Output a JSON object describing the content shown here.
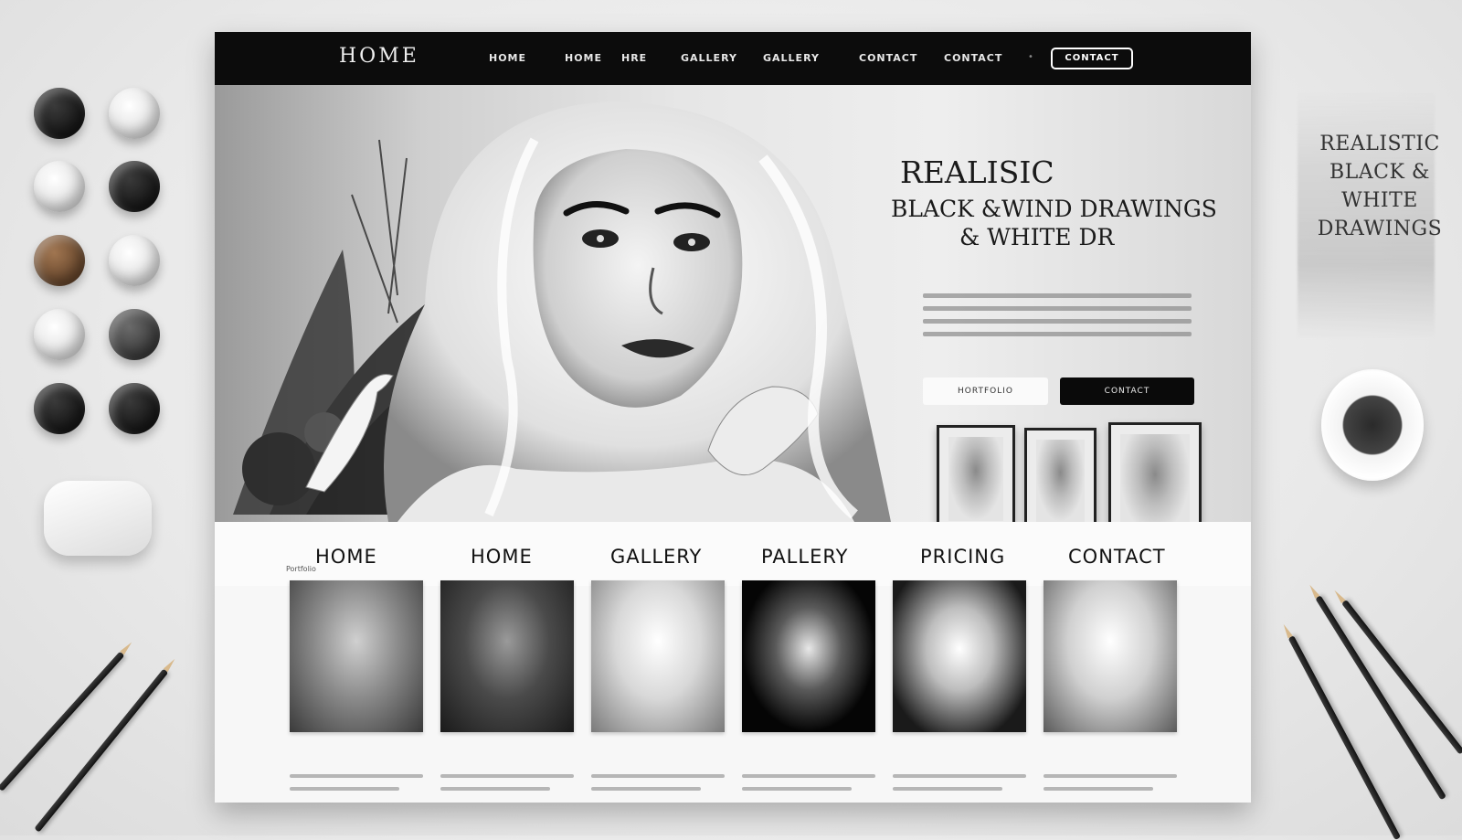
{
  "site": {
    "brand": "HOME",
    "top_nav": [
      {
        "label": "HOME"
      },
      {
        "label": "HOME"
      },
      {
        "label": "HRE"
      },
      {
        "label": "GALLERY"
      },
      {
        "label": "GALLERY"
      },
      {
        "label": "CONTACT"
      },
      {
        "label": "CONTACT"
      }
    ],
    "top_nav_button": "CONTACT",
    "hero": {
      "title_line1": "REALISIC",
      "title_line2": "BLACK &WIND DRAWINGS",
      "title_line3": "& WHITE DR",
      "primary_button": "HORTFOLIO",
      "secondary_button": "CONTACT"
    },
    "sub_nav": [
      {
        "label": "HOME"
      },
      {
        "label": "HOME"
      },
      {
        "label": "GALLERY"
      },
      {
        "label": "PALLERY"
      },
      {
        "label": "PRICING"
      },
      {
        "label": "CONTACT"
      }
    ],
    "breadcrumb": "Portfolio",
    "gallery_count": 6
  },
  "desk": {
    "side_card_title_line1": "REALISTIC",
    "side_card_title_line2": "BLACK & WHITE",
    "side_card_title_line3": "DRAWINGS"
  },
  "colors": {
    "nav_background": "#0c0c0c",
    "page_background": "#f7f7f7",
    "accent_dark": "#0a0a0a",
    "accent_light": "#fafafa"
  }
}
